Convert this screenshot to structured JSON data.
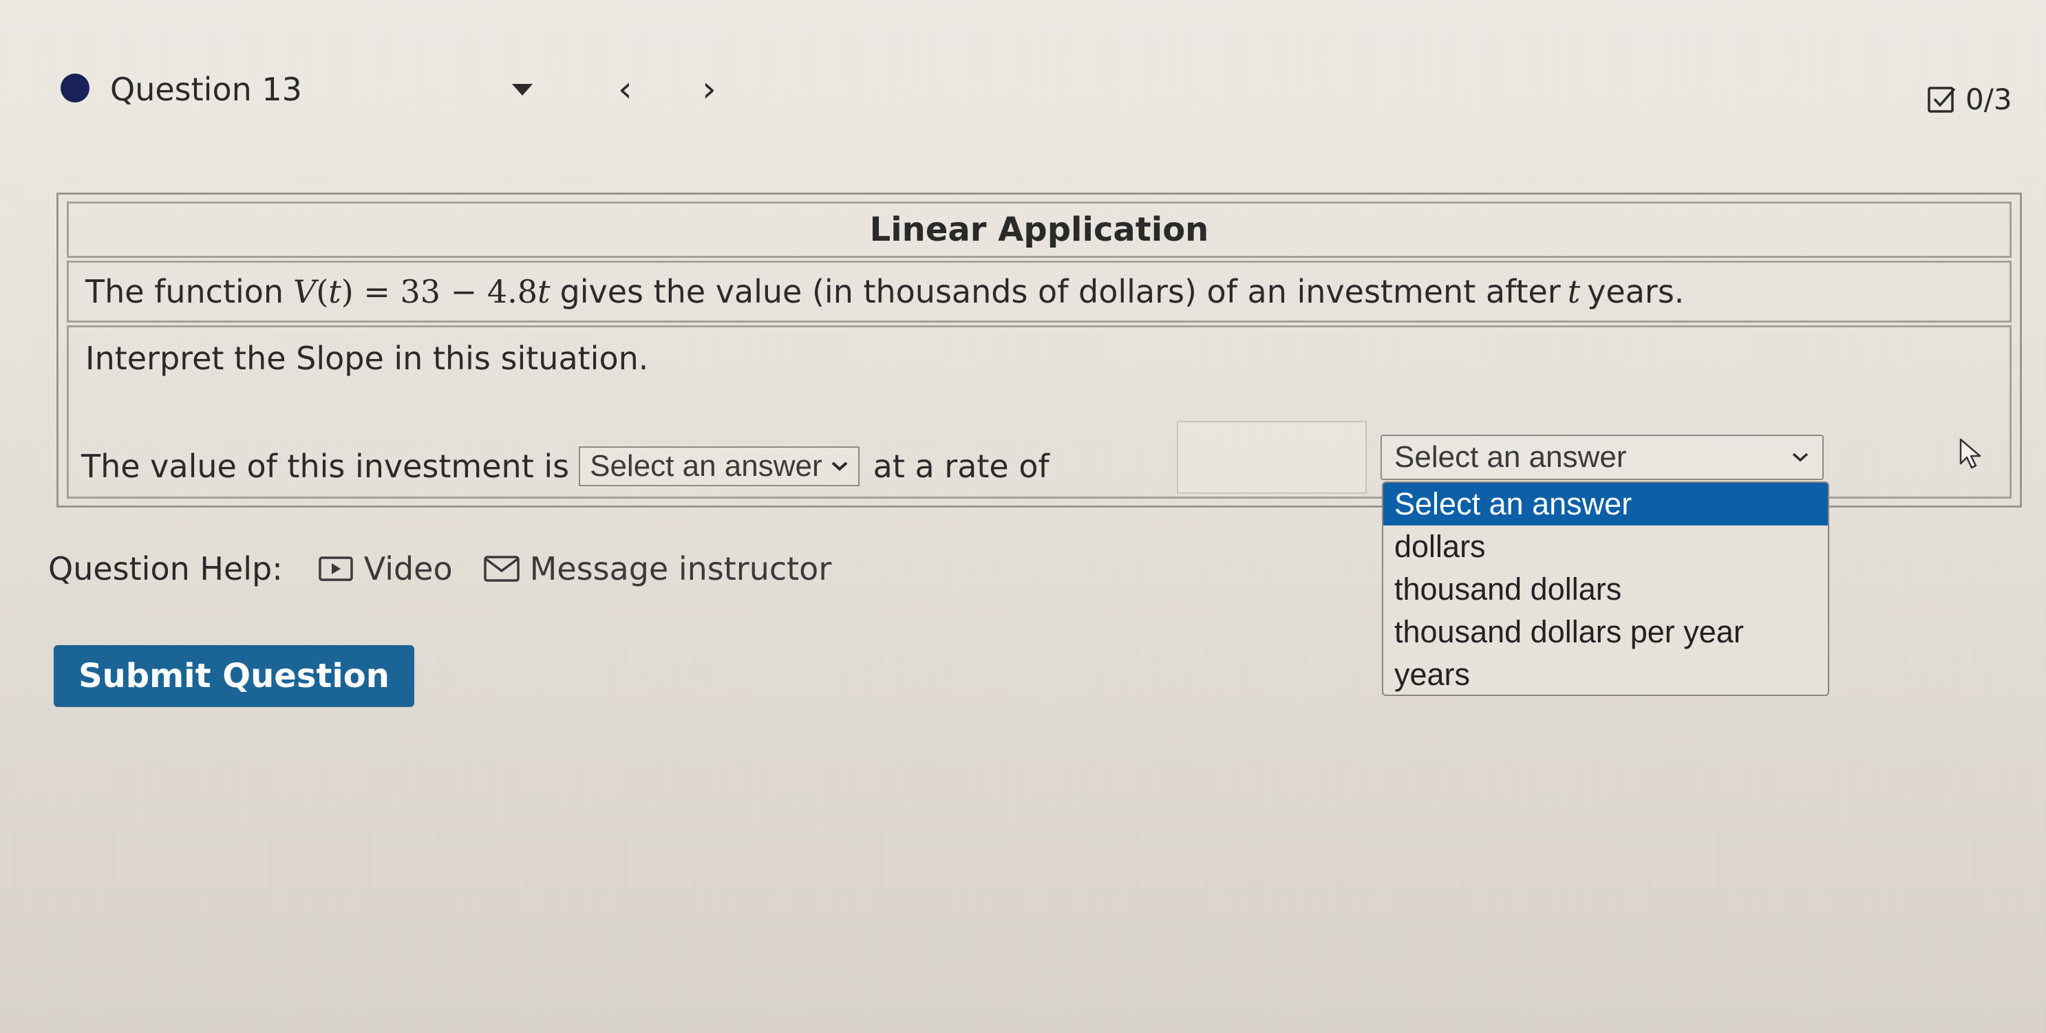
{
  "question": {
    "title": "Question 13",
    "prev_icon": "chevron-left",
    "next_icon": "chevron-right",
    "score": "0/3"
  },
  "problem": {
    "heading": "Linear Application",
    "statement_before": "The function",
    "function_lhs": "V",
    "function_arg": "t",
    "function_rhs": "= 33 − 4.8",
    "function_var": "t",
    "statement_mid": "gives the value (in thousands of dollars) of an investment after",
    "statement_var": "t",
    "statement_after": "years.",
    "prompt": "Interpret the Slope in this situation.",
    "answer_prefix": "The value of this investment is",
    "select1_value": "Select an answer",
    "rate_label": "at a rate of",
    "rate_value": "",
    "select2_value": "Select an answer"
  },
  "dropdown": {
    "options": [
      "Select an answer",
      "dollars",
      "thousand dollars",
      "thousand dollars per year",
      "years"
    ],
    "highlighted_index": 0,
    "highlight_color": "#0d5fa8"
  },
  "help": {
    "label": "Question Help:",
    "video_label": "Video",
    "message_label": "Message instructor"
  },
  "submit": {
    "label": "Submit Question",
    "color": "#1b6496"
  }
}
